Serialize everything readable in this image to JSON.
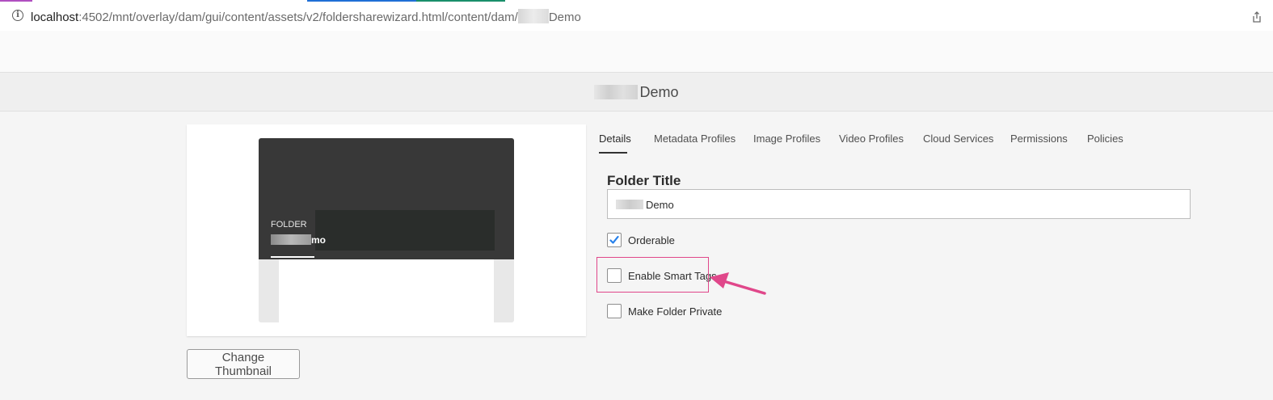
{
  "browser": {
    "url_host": "localhost",
    "url_path": ":4502/mnt/overlay/dam/gui/content/assets/v2/foldersharewizard.html/content/dam/",
    "url_tail": "Demo"
  },
  "header": {
    "title": "Demo"
  },
  "thumbnail": {
    "type_label": "FOLDER",
    "name_suffix": "mo",
    "change_button": "Change Thumbnail"
  },
  "tabs": [
    {
      "label": "Details",
      "active": true
    },
    {
      "label": "Metadata Profiles"
    },
    {
      "label": "Image Profiles"
    },
    {
      "label": "Video Profiles"
    },
    {
      "label": "Cloud Services"
    },
    {
      "label": "Permissions"
    },
    {
      "label": "Policies"
    }
  ],
  "form": {
    "folder_title_label": "Folder Title",
    "folder_title_value": "Demo",
    "orderable": {
      "label": "Orderable",
      "checked": true
    },
    "smart_tags": {
      "label": "Enable Smart Tags",
      "checked": false
    },
    "private": {
      "label": "Make Folder Private",
      "checked": false
    }
  },
  "colors": {
    "annotation": "#e0478a",
    "checkbox_accent": "#2680eb"
  }
}
